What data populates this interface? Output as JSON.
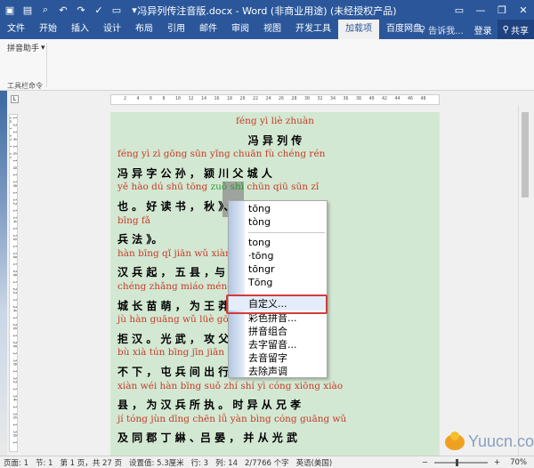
{
  "titlebar": {
    "title": "冯异列传注音版.docx - Word (非商业用途) (未经授权产品)",
    "icons": [
      "save-icon",
      "print-preview-icon",
      "search-icon",
      "undo-icon",
      "redo-icon",
      "check-icon",
      "open-folder-icon",
      "more-icon"
    ]
  },
  "tabs": [
    "文件",
    "开始",
    "插入",
    "设计",
    "布局",
    "引用",
    "邮件",
    "审阅",
    "视图",
    "开发工具",
    "加载项",
    "百度网盘"
  ],
  "active_tab": "加载项",
  "tell_me": "告诉我...",
  "sign_in": "登录",
  "share": "共享",
  "ribbon": {
    "button": "拼音助手",
    "group": "工具栏命令"
  },
  "document": {
    "lines": [
      {
        "type": "py",
        "text": "féng yì liè zhuàn"
      },
      {
        "type": "hz",
        "text": "冯 异 列 传"
      },
      {
        "type": "py",
        "text": "féng yì zì gōng sūn   yǐng chuān fù chéng rén"
      },
      {
        "type": "hz",
        "text": "冯 异 字 公 孙 ， 颍 川 父 城 人"
      },
      {
        "type": "py",
        "text": "yě   hào dú shū   tōng   zuǒ shì chūn qiū      sūn zǐ"
      },
      {
        "type": "hz",
        "text": "也 。 好 读 书 ，                秋 》、《 孙 子"
      },
      {
        "type": "py",
        "text": "bīng fǎ"
      },
      {
        "type": "hz",
        "text": "兵  法 》。"
      },
      {
        "type": "py",
        "text": "hàn bīng qǐ               jiān wǔ xiàn   yǔ wáng"
      },
      {
        "type": "hz",
        "text": "汉  兵  起 ，               五 县 ，与 父"
      },
      {
        "type": "py",
        "text": "chéng zhǎng miáo méng            wèi wáng mǎng"
      },
      {
        "type": "hz",
        "text": "城   长   苗   萌               ， 为  王   莽"
      },
      {
        "type": "py",
        "text": "jù hàn   guāng wǔ lüè            gōng fù chéng"
      },
      {
        "type": "hz",
        "text": "拒 汉 。 光 武                  ， 攻 父   城"
      },
      {
        "type": "py",
        "text": "bù xià   tún bīng jīn            jiān chū xíng shǔ"
      },
      {
        "type": "hz",
        "text": "不 下 ， 屯   兵                间   出   行   属"
      },
      {
        "type": "py",
        "text": "xiàn   wéi hàn bīng suǒ zhí    shí yì cóng xiōng xiào"
      },
      {
        "type": "hz",
        "text": "县 ， 为 汉  兵  所  执 。 时 异 从  兄   孝"
      },
      {
        "type": "py",
        "text": "jí tóng jùn dīng chēn    lǚ yàn   bìng cóng guāng wǔ"
      },
      {
        "type": "hz",
        "text": "及 同  郡  丁   綝 、吕 晏 ， 并   从   光  武"
      }
    ]
  },
  "context_menu": {
    "items": [
      "tōng",
      "tòng",
      "tong",
      "·tōng",
      "tōngr",
      "Tōng",
      "自定义...",
      "彩色拼音...",
      "拼音组合",
      "去字留音...",
      "去音留字",
      "去除声调"
    ],
    "highlighted": "自定义..."
  },
  "statusbar": {
    "page": "页面: 1",
    "section": "节: 1",
    "page_of": "第 1 页，共 27 页",
    "position": "设置值: 5.3厘米",
    "row": "行: 3",
    "col": "列: 14",
    "words": "2/7766 个字",
    "lang": "英语(美国)",
    "zoom": "70%",
    "zoom_minus": "−",
    "zoom_plus": "+"
  },
  "watermark": "Yuucn.com",
  "colors": {
    "title_blue": "#2b579a",
    "page_green": "#d3e8d2",
    "pinyin_red": "#c43c2a",
    "highlight_red": "#d23c3c"
  }
}
